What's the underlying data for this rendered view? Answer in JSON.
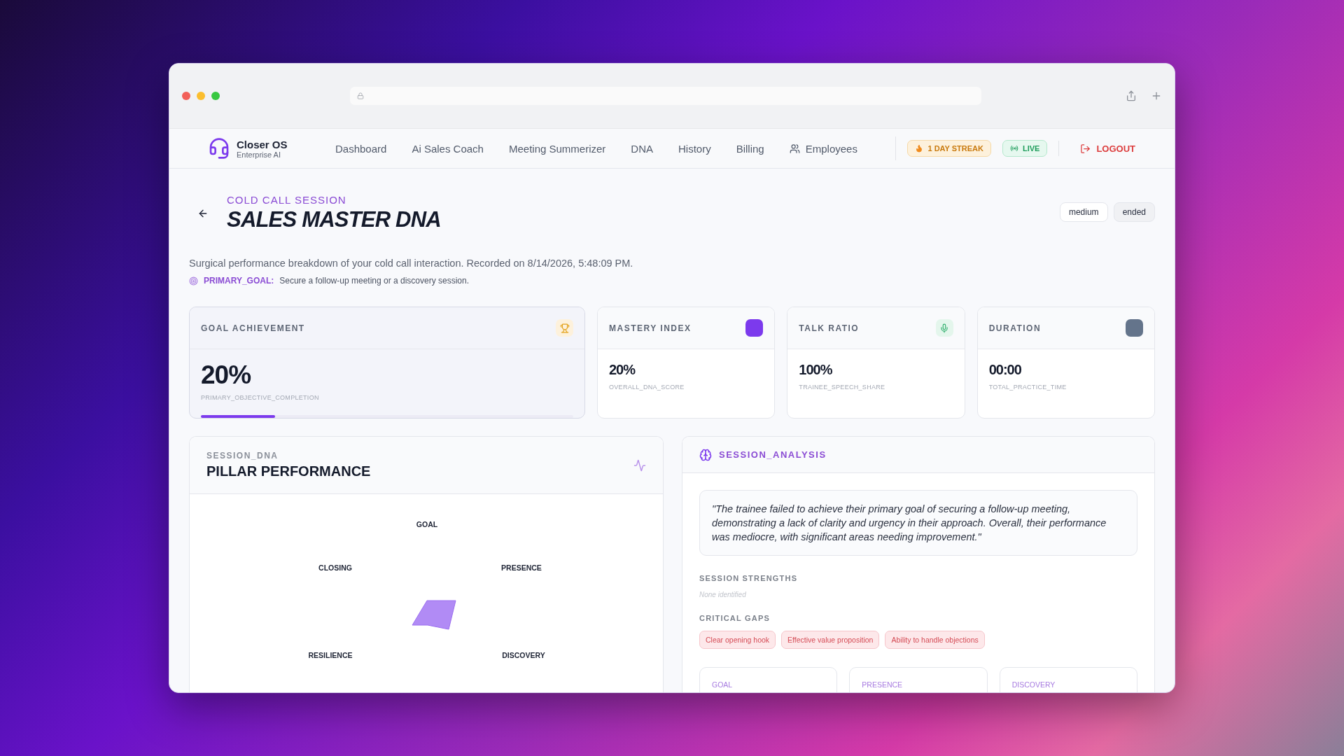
{
  "brand": {
    "name": "Closer OS",
    "subtitle": "Enterprise AI"
  },
  "nav": [
    {
      "label": "Dashboard",
      "selected": false
    },
    {
      "label": "Ai Sales Coach",
      "selected": false
    },
    {
      "label": "Meeting Summerizer",
      "selected": false
    },
    {
      "label": "DNA",
      "selected": false
    },
    {
      "label": "History",
      "selected": false
    },
    {
      "label": "Billing",
      "selected": false
    },
    {
      "label": "Employees",
      "selected": false,
      "kind": "people"
    }
  ],
  "streak": "1 DAY STREAK",
  "live": "LIVE",
  "logout": "LOGOUT",
  "header": {
    "eyebrow": "COLD CALL SESSION",
    "title": "SALES MASTER DNA",
    "badges": [
      "medium",
      "ended"
    ],
    "description": "Surgical performance breakdown of your cold call interaction. Recorded on 8/14/2026, 5:48:09 PM.",
    "goal_label": "PRIMARY_GOAL:",
    "goal_text": "Secure a follow-up meeting or a discovery session."
  },
  "stats": [
    {
      "kind": "goal",
      "label": "GOAL ACHIEVEMENT",
      "value": "20%",
      "caption": "PRIMARY_OBJECTIVE_COMPLETION",
      "level": 0.2
    },
    {
      "kind": "mastery",
      "label": "MASTERY INDEX",
      "value": "20%",
      "caption": "OVERALL_DNA_SCORE"
    },
    {
      "kind": "talk",
      "label": "TALK RATIO",
      "value": "100%",
      "caption": "TRAINEE_SPEECH_SHARE"
    },
    {
      "kind": "duration",
      "label": "DURATION",
      "value": "00:00",
      "caption": "TOTAL_PRACTICE_TIME"
    }
  ],
  "pillars": {
    "eyebrow": "SESSION_DNA",
    "title": "PILLAR PERFORMANCE",
    "axes": [
      "GOAL",
      "PRESENCE",
      "DISCOVERY",
      "RESILIENCE",
      "CLOSING"
    ]
  },
  "analysis": {
    "title": "SESSION_ANALYSIS",
    "quote": "\"The trainee failed to achieve their primary goal of securing a follow-up meeting, demonstrating a lack of clarity and urgency in their approach. Overall, their performance was mediocre, with significant areas needing improvement.\"",
    "strengths_title": "SESSION STRENGTHS",
    "strengths_empty": "None identified",
    "gaps_title": "CRITICAL GAPS",
    "gaps": [
      "Clear opening hook",
      "Effective value proposition",
      "Ability to handle objections"
    ],
    "pillar_cards": [
      "GOAL",
      "PRESENCE",
      "DISCOVERY"
    ]
  }
}
